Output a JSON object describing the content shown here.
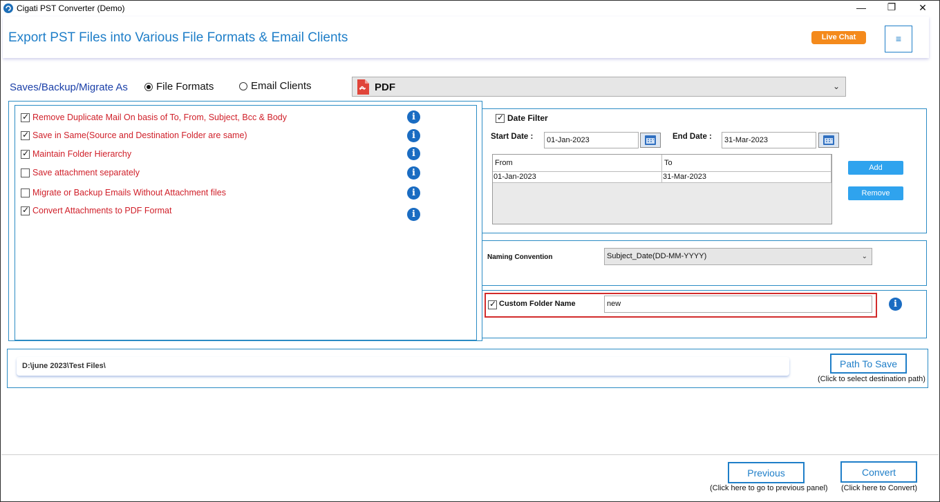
{
  "window": {
    "title": "Cigati PST Converter (Demo)",
    "controls": [
      "—",
      "❐",
      "✕"
    ]
  },
  "header": {
    "title": "Export PST Files into Various File Formats & Email Clients",
    "live_chat": "Live Chat",
    "menu_icon": "≡"
  },
  "saves": {
    "label": "Saves/Backup/Migrate As",
    "options": [
      {
        "label": "File Formats",
        "selected": true
      },
      {
        "label": "Email Clients",
        "selected": false
      }
    ],
    "format_selected": "PDF",
    "format_icon": "pdf-file-icon"
  },
  "options": [
    {
      "label": "Remove Duplicate Mail On basis of To, From, Subject, Bcc & Body",
      "checked": true
    },
    {
      "label": "Save in Same(Source and Destination Folder are same)",
      "checked": true
    },
    {
      "label": "Maintain Folder Hierarchy",
      "checked": true
    },
    {
      "label": "Save attachment separately",
      "checked": false
    },
    {
      "label": "Migrate or Backup Emails Without Attachment files",
      "checked": false
    },
    {
      "label": "Convert Attachments to PDF Format",
      "checked": true
    }
  ],
  "date_filter": {
    "label": "Date Filter",
    "checked": true,
    "start_label": "Start Date :",
    "start_value": "01-Jan-2023",
    "end_label": "End Date :",
    "end_value": "31-Mar-2023",
    "columns": [
      "From",
      "To"
    ],
    "rows": [
      [
        "01-Jan-2023",
        "31-Mar-2023"
      ]
    ],
    "add": "Add",
    "remove": "Remove"
  },
  "naming": {
    "label": "Naming Convention",
    "value": "Subject_Date(DD-MM-YYYY)"
  },
  "custom_folder": {
    "label": "Custom Folder Name",
    "checked": true,
    "value": "new"
  },
  "path": {
    "value": "D:\\june 2023\\Test Files\\",
    "button": "Path To Save",
    "hint": "(Click to select destination path)"
  },
  "footer": {
    "previous": "Previous",
    "previous_hint": "(Click here to go to previous panel)",
    "convert": "Convert",
    "convert_hint": "(Click here to Convert)"
  },
  "colors": {
    "accent": "#1e7ec8",
    "option_text": "#d0202a",
    "live_chat": "#f48a1c",
    "highlight_box": "#d22b2b"
  }
}
